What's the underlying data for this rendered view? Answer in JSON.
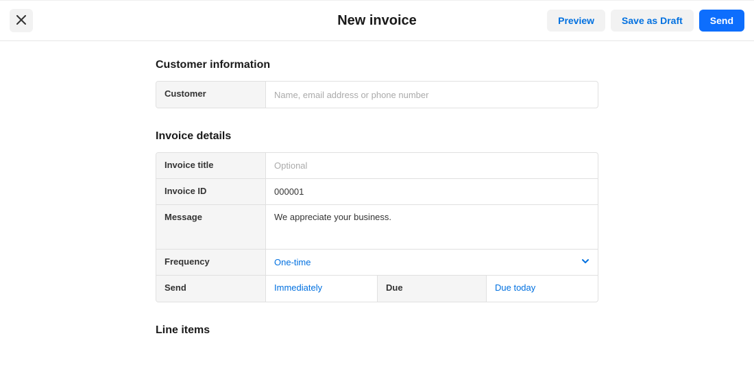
{
  "header": {
    "title": "New invoice",
    "preview_label": "Preview",
    "save_draft_label": "Save as Draft",
    "send_label": "Send"
  },
  "customer_section": {
    "title": "Customer information",
    "customer_label": "Customer",
    "customer_placeholder": "Name, email address or phone number",
    "customer_value": ""
  },
  "details_section": {
    "title": "Invoice details",
    "invoice_title_label": "Invoice title",
    "invoice_title_placeholder": "Optional",
    "invoice_title_value": "",
    "invoice_id_label": "Invoice ID",
    "invoice_id_value": "000001",
    "message_label": "Message",
    "message_value": "We appreciate your business.",
    "frequency_label": "Frequency",
    "frequency_value": "One-time",
    "send_label": "Send",
    "send_value": "Immediately",
    "due_label": "Due",
    "due_value": "Due today"
  },
  "line_items_section": {
    "title": "Line items"
  },
  "colors": {
    "primary": "#0d6efd",
    "link": "#0070e0"
  }
}
